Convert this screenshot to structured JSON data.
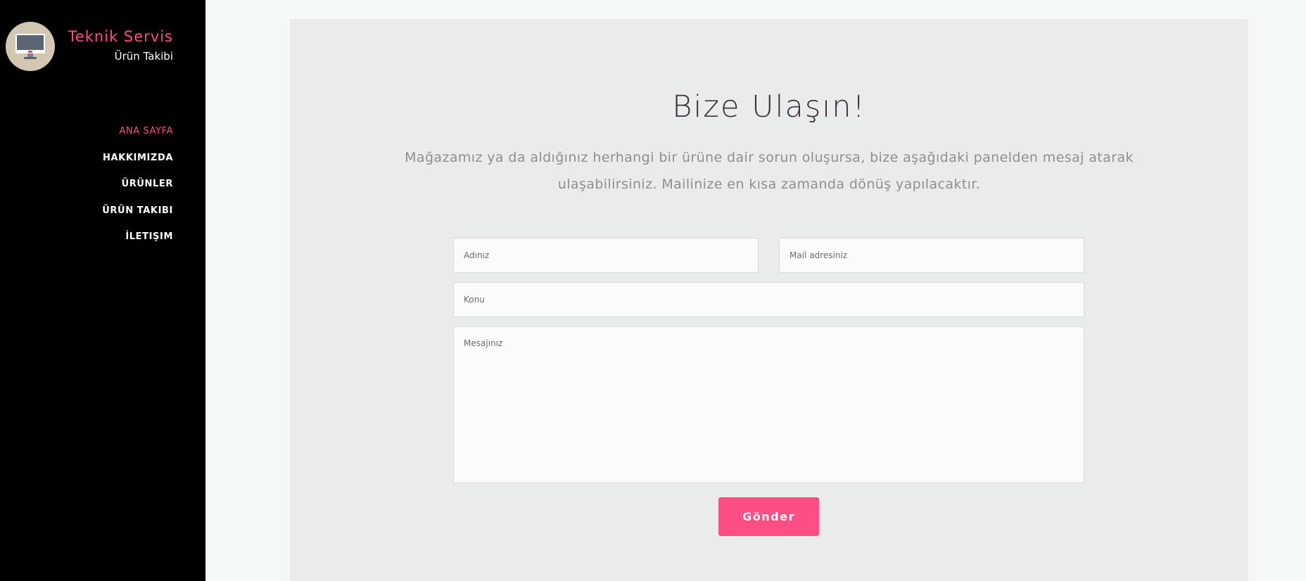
{
  "brand": {
    "title": "Teknik Servis",
    "subtitle": "Ürün Takibi",
    "logo_icon": "desktop-monitor-icon"
  },
  "nav": {
    "items": [
      {
        "label": "ANA SAYFA",
        "active": true
      },
      {
        "label": "HAKKIMIZDA",
        "active": false
      },
      {
        "label": "ÜRÜNLER",
        "active": false
      },
      {
        "label": "ÜRÜN TAKIBI",
        "active": false
      },
      {
        "label": "İLETIŞIM",
        "active": false
      }
    ]
  },
  "contact": {
    "heading": "Bize Ulaşın!",
    "intro": "Mağazamız ya da aldığınız herhangi bir ürüne dair sorun oluşursa, bize aşağıdaki panelden mesaj atarak ulaşabilirsiniz. Mailinize en kısa zamanda dönüş yapılacaktır.",
    "form": {
      "name_placeholder": "Adınız",
      "email_placeholder": "Mail adresiniz",
      "subject_placeholder": "Konu",
      "message_placeholder": "Mesajınız",
      "submit_label": "Gönder"
    }
  },
  "colors": {
    "accent": "#ff4e83",
    "sidebar_bg": "#000000",
    "page_bg": "#f4f9f8",
    "panel_bg": "#e9ecea",
    "heading": "#3c2f3a",
    "body_text": "#8f8f8f"
  }
}
